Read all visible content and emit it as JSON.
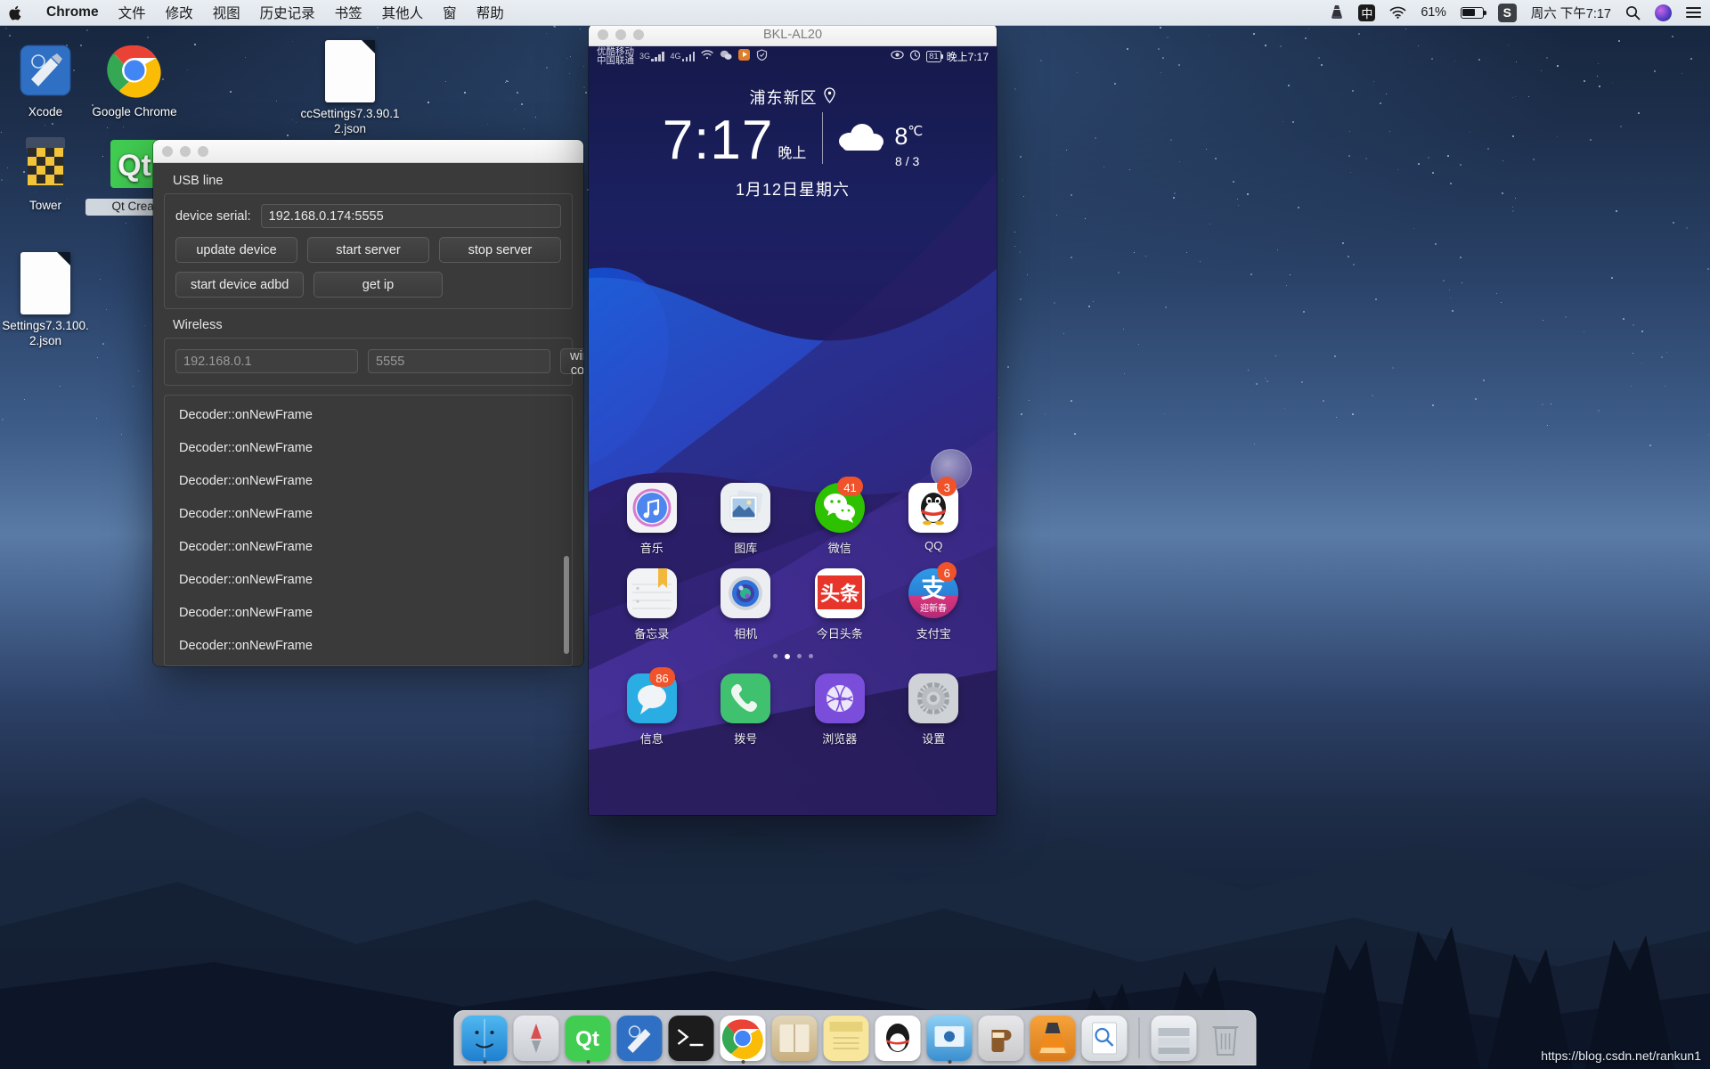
{
  "menubar": {
    "apple_icon": "apple-logo-icon",
    "items": [
      {
        "label": "Chrome",
        "bold": true
      },
      {
        "label": "文件",
        "bold": false
      },
      {
        "label": "修改",
        "bold": false
      },
      {
        "label": "视图",
        "bold": false
      },
      {
        "label": "历史记录",
        "bold": false
      },
      {
        "label": "书签",
        "bold": false
      },
      {
        "label": "其他人",
        "bold": false
      },
      {
        "label": "窗",
        "bold": false
      },
      {
        "label": "帮助",
        "bold": false
      }
    ],
    "status": {
      "vlc_icon": "vlc-cone-icon",
      "input_method_icon": "中",
      "wifi_icon": "wifi-icon",
      "battery_percent": "61%",
      "battery_icon": "battery-icon",
      "sogou_icon": "S",
      "clock": "周六 下午7:17",
      "search_icon": "search-icon",
      "siri_icon": "siri-icon",
      "notification_center_icon": "notification-center-icon"
    }
  },
  "desktop_icons": [
    {
      "name": "Xcode",
      "label": "Xcode",
      "icon": "xcode-icon"
    },
    {
      "name": "Google Chrome",
      "label": "Google Chrome",
      "icon": "chrome-icon"
    },
    {
      "name": "ccSettings",
      "label": "ccSettings7.3.90.1\n2.json",
      "icon": "json-file-icon"
    },
    {
      "name": "Tower",
      "label": "Tower",
      "icon": "tower-icon"
    },
    {
      "name": "Qt Creator",
      "label": "Qt Creat",
      "icon": "qt-creator-icon"
    },
    {
      "name": "Settings",
      "label": "Settings7.3.100.\n2.json",
      "icon": "json-file-icon"
    }
  ],
  "qt_window": {
    "traffic_lights": [
      "close",
      "minimize",
      "zoom"
    ],
    "usb_group": {
      "title": "USB line",
      "device_serial_label": "device serial:",
      "device_serial_value": "192.168.0.174:5555",
      "buttons": [
        "update device",
        "start server",
        "stop server",
        "start device adbd",
        "get ip"
      ]
    },
    "wireless_group": {
      "title": "Wireless",
      "ip_placeholder": "192.168.0.1",
      "ip_value": "",
      "port_placeholder": "5555",
      "port_value": "",
      "connect_button": "wireless connect"
    },
    "log": {
      "lines": [
        "Decoder::onNewFrame",
        "Decoder::onNewFrame",
        "Decoder::onNewFrame",
        "Decoder::onNewFrame",
        "Decoder::onNewFrame",
        "Decoder::onNewFrame",
        "Decoder::onNewFrame",
        "Decoder::onNewFrame"
      ]
    }
  },
  "phone_window": {
    "title": "BKL-AL20",
    "traffic_lights": [
      "close",
      "minimize",
      "zoom"
    ],
    "status_bar": {
      "carrier_line1": "优酷移动",
      "carrier_line2": "中国联通",
      "net1": "3G",
      "net2": "4G",
      "wifi_icon": "wifi-icon",
      "wechat_icon": "wechat-icon",
      "player_icon": "video-player-icon",
      "shield_icon": "shield-icon",
      "eye_icon": "eye-comfort-icon",
      "alarm_icon": "alarm-icon",
      "battery_level": "81",
      "time": "晚上7:17"
    },
    "clock_widget": {
      "location": "浦东新区",
      "location_icon": "location-pin-icon",
      "time": "7:17",
      "ampm": "晚上",
      "weather_icon": "cloudy-icon",
      "temperature": "8",
      "temperature_unit": "℃",
      "high_low": "8 / 3",
      "date": "1月12日星期六"
    },
    "page_dots": {
      "count": 4,
      "active_index": 1
    },
    "app_rows": [
      [
        {
          "label": "音乐",
          "icon": "music-app-icon",
          "badge": ""
        },
        {
          "label": "图库",
          "icon": "gallery-app-icon",
          "badge": ""
        },
        {
          "label": "微信",
          "icon": "wechat-app-icon",
          "badge": "41"
        },
        {
          "label": "QQ",
          "icon": "qq-app-icon",
          "badge": "3"
        }
      ],
      [
        {
          "label": "备忘录",
          "icon": "notes-app-icon",
          "badge": ""
        },
        {
          "label": "相机",
          "icon": "camera-app-icon",
          "badge": ""
        },
        {
          "label": "今日头条",
          "icon": "toutiao-app-icon",
          "badge": ""
        },
        {
          "label": "支付宝",
          "icon": "alipay-app-icon",
          "badge": "6"
        }
      ]
    ],
    "dock_apps": [
      {
        "label": "信息",
        "icon": "messages-app-icon",
        "badge": "86"
      },
      {
        "label": "拨号",
        "icon": "phone-app-icon",
        "badge": ""
      },
      {
        "label": "浏览器",
        "icon": "browser-app-icon",
        "badge": ""
      },
      {
        "label": "设置",
        "icon": "settings-app-icon",
        "badge": ""
      }
    ]
  },
  "dock": {
    "items": [
      {
        "name": "finder-dock-icon",
        "label": "Finder"
      },
      {
        "name": "launchpad-dock-icon",
        "label": "Launchpad"
      },
      {
        "name": "qtcreator-dock-icon",
        "label": "Qt Creator"
      },
      {
        "name": "xcode-dock-icon",
        "label": "Xcode"
      },
      {
        "name": "terminal-dock-icon",
        "label": "Terminal"
      },
      {
        "name": "chrome-dock-icon",
        "label": "Google Chrome"
      },
      {
        "name": "dictionary-dock-icon",
        "label": "Dictionary"
      },
      {
        "name": "notes-dock-icon",
        "label": "Notes"
      },
      {
        "name": "qq-dock-icon",
        "label": "QQ"
      },
      {
        "name": "screensharing-dock-icon",
        "label": "Screen Sharing"
      },
      {
        "name": "homebrew-dock-icon",
        "label": "Homebrew"
      },
      {
        "name": "vlc-dock-icon",
        "label": "VLC"
      },
      {
        "name": "preview-dock-icon",
        "label": "Preview"
      },
      {
        "name": "downloads-dock-icon",
        "label": "Downloads"
      },
      {
        "name": "trash-dock-icon",
        "label": "Trash"
      }
    ]
  },
  "watermark": "https://blog.csdn.net/rankun1"
}
